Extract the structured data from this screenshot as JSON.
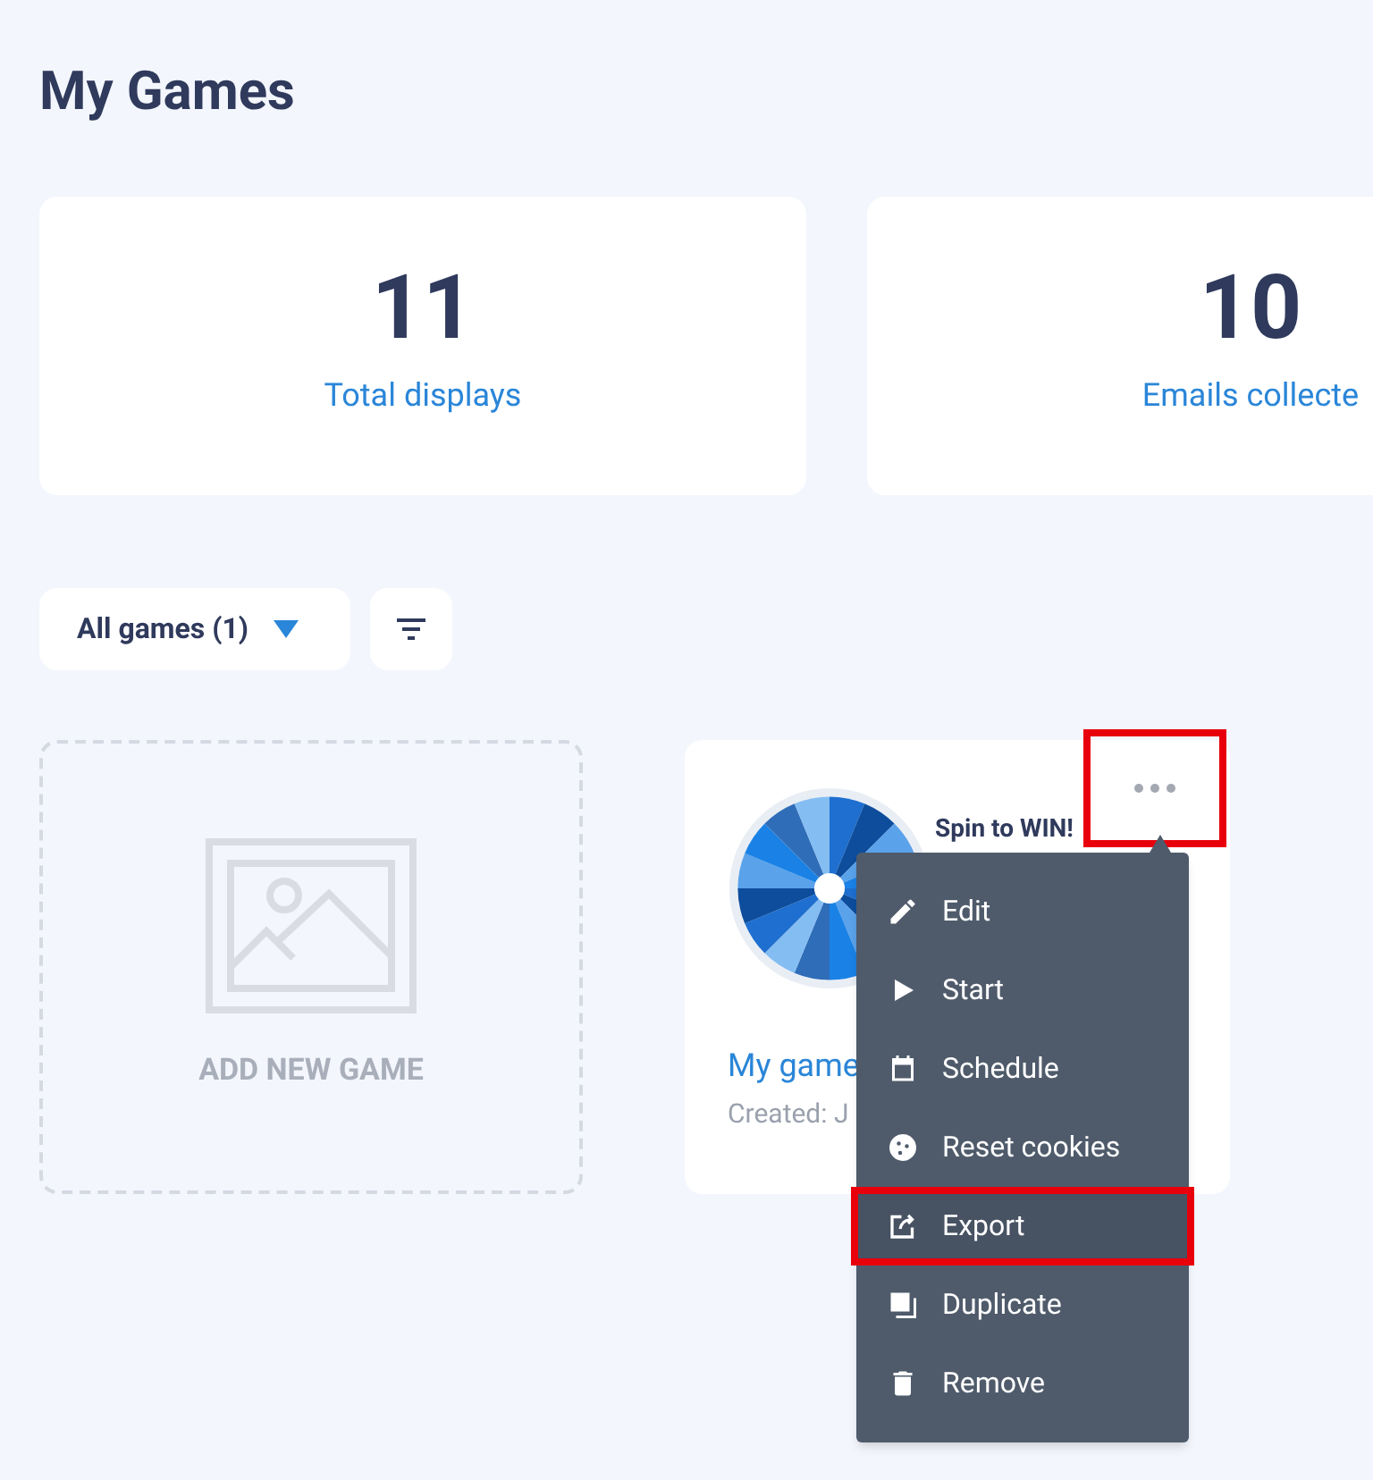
{
  "page_title": "My Games",
  "stats": [
    {
      "value": "11",
      "label": "Total displays"
    },
    {
      "value": "10",
      "label": "Emails collecte"
    }
  ],
  "filter": {
    "dropdown": "All games (1)"
  },
  "add_card": {
    "label": "ADD NEW GAME"
  },
  "game_card": {
    "banner": "Spin to WIN!",
    "name": "My game",
    "created": "Created: J",
    "menu_button_highlighted": true
  },
  "menu": [
    {
      "kind": "edit",
      "label": "Edit",
      "highlighted": false
    },
    {
      "kind": "start",
      "label": "Start",
      "highlighted": false
    },
    {
      "kind": "schedule",
      "label": "Schedule",
      "highlighted": false
    },
    {
      "kind": "cookies",
      "label": "Reset cookies",
      "highlighted": false
    },
    {
      "kind": "export",
      "label": "Export",
      "highlighted": true
    },
    {
      "kind": "duplicate",
      "label": "Duplicate",
      "highlighted": false
    },
    {
      "kind": "remove",
      "label": "Remove",
      "highlighted": false
    }
  ]
}
